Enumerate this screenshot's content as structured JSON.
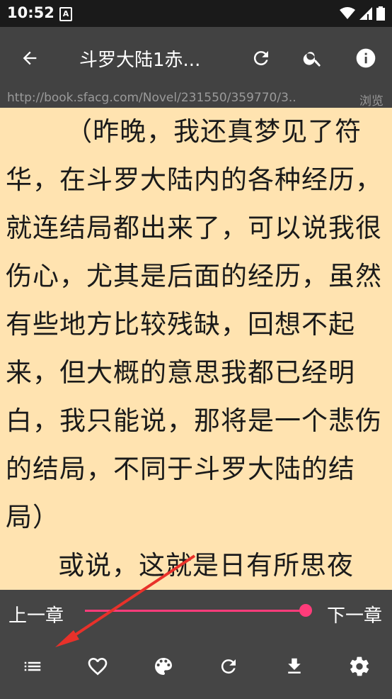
{
  "status_bar": {
    "time": "10:52",
    "notification_icon": "A"
  },
  "toolbar": {
    "title": "斗罗大陆1赤...",
    "back_icon": "arrow-left",
    "refresh_icon": "refresh",
    "search_icon": "search",
    "info_icon": "info"
  },
  "url_bar": {
    "url": "http://book.sfacg.com/Novel/231550/359770/3..",
    "browse_label": "浏览"
  },
  "content": {
    "paragraphs": [
      "（昨晚，我还真梦见了符华，在斗罗大陆内的各种经历，就连结局都出来了，可以说我很伤心，尤其是后面的经历，虽然有些地方比较残缺，回想不起来，但大概的意思我都已经明白，我只能说，那将是一个悲伤的结局，不同于斗罗大陆的结局）",
      "或说，这就是日有所思夜"
    ]
  },
  "bottom_bar": {
    "prev_label": "上一章",
    "next_label": "下一章",
    "progress": 1.0,
    "icons": [
      "list-icon",
      "heart-icon",
      "palette-icon",
      "refresh-icon",
      "download-icon",
      "settings-icon"
    ]
  },
  "colors": {
    "page_bg": "#FFE3B0",
    "toolbar_bg": "#424242",
    "accent": "#FF3C7A",
    "annotation": "#E8312A"
  }
}
